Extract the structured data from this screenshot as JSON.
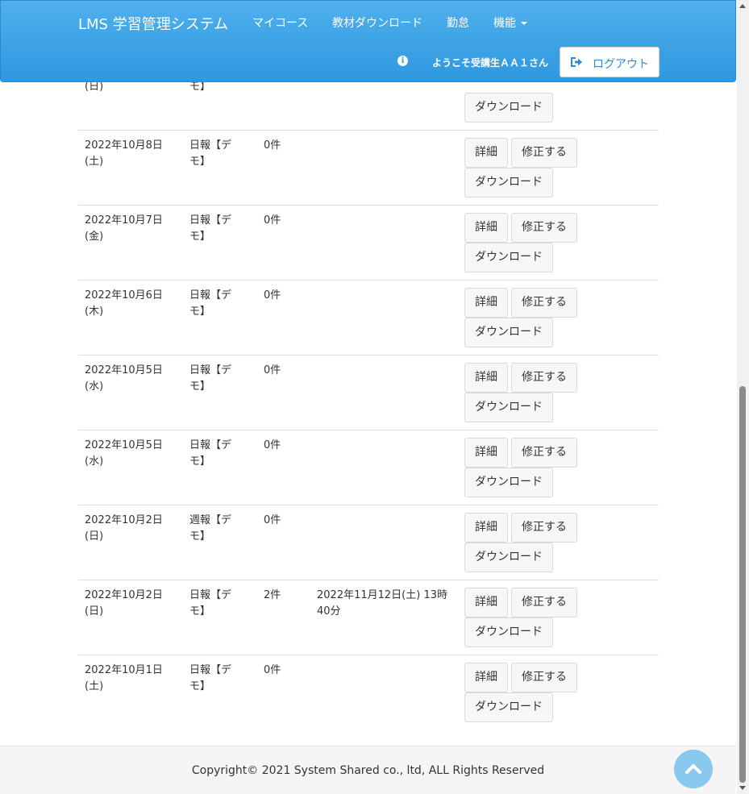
{
  "nav": {
    "brand": "LMS 学習管理システム",
    "items": [
      "マイコース",
      "教材ダウンロード",
      "勤怠",
      "機能"
    ],
    "welcome": "ようこそ受講生ＡＡ１さん",
    "logout": "ログアウト"
  },
  "partial_row": {
    "date_line2": "(日)",
    "kind_line2": "モ】",
    "download": "ダウンロード"
  },
  "rows": [
    {
      "date1": "2022年10月8日",
      "date2": "(土)",
      "kind1": "日報【デ",
      "kind2": "モ】",
      "count": "0件",
      "time1": "",
      "time2": "",
      "detail": "詳細",
      "edit": "修正する",
      "download": "ダウンロード"
    },
    {
      "date1": "2022年10月7日",
      "date2": "(金)",
      "kind1": "日報【デ",
      "kind2": "モ】",
      "count": "0件",
      "time1": "",
      "time2": "",
      "detail": "詳細",
      "edit": "修正する",
      "download": "ダウンロード"
    },
    {
      "date1": "2022年10月6日",
      "date2": "(木)",
      "kind1": "日報【デ",
      "kind2": "モ】",
      "count": "0件",
      "time1": "",
      "time2": "",
      "detail": "詳細",
      "edit": "修正する",
      "download": "ダウンロード"
    },
    {
      "date1": "2022年10月5日",
      "date2": "(水)",
      "kind1": "日報【デ",
      "kind2": "モ】",
      "count": "0件",
      "time1": "",
      "time2": "",
      "detail": "詳細",
      "edit": "修正する",
      "download": "ダウンロード"
    },
    {
      "date1": "2022年10月5日",
      "date2": "(水)",
      "kind1": "日報【デ",
      "kind2": "モ】",
      "count": "0件",
      "time1": "",
      "time2": "",
      "detail": "詳細",
      "edit": "修正する",
      "download": "ダウンロード"
    },
    {
      "date1": "2022年10月2日",
      "date2": "(日)",
      "kind1": "週報【デ",
      "kind2": "モ】",
      "count": "0件",
      "time1": "",
      "time2": "",
      "detail": "詳細",
      "edit": "修正する",
      "download": "ダウンロード"
    },
    {
      "date1": "2022年10月2日",
      "date2": "(日)",
      "kind1": "日報【デ",
      "kind2": "モ】",
      "count": "2件",
      "time1": "2022年11月12日(土) 13時",
      "time2": "40分",
      "detail": "詳細",
      "edit": "修正する",
      "download": "ダウンロード"
    },
    {
      "date1": "2022年10月1日",
      "date2": "(土)",
      "kind1": "日報【デ",
      "kind2": "モ】",
      "count": "0件",
      "time1": "",
      "time2": "",
      "detail": "詳細",
      "edit": "修正する",
      "download": "ダウンロード"
    }
  ],
  "footer": {
    "copyright": "Copyright© 2021 System Shared co., ltd, ALL Rights Reserved"
  },
  "icons": {
    "info": "info-icon",
    "logout": "sign-out-icon",
    "back_to_top": "chevron-up-icon"
  },
  "colors": {
    "navbar": "#3aa3e8",
    "logout_text": "#2f88d8",
    "back_to_top": "#89c8ef"
  }
}
